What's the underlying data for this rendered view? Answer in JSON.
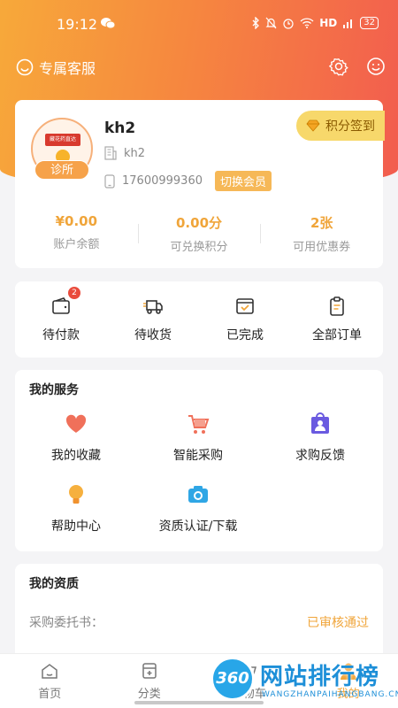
{
  "status_bar": {
    "time": "19:12",
    "network": "HD",
    "battery": "32"
  },
  "topbar": {
    "customer_service": "专属客服"
  },
  "profile": {
    "avatar_sign_text": "藏花药直达",
    "clinic_tag": "诊所",
    "username": "kh2",
    "org_name": "kh2",
    "phone": "17600999360",
    "switch_member": "切换会员",
    "points_signin": "积分签到",
    "stats": [
      {
        "value": "¥0.00",
        "label": "账户余额"
      },
      {
        "value": "0.00分",
        "label": "可兑换积分"
      },
      {
        "value": "2张",
        "label": "可用优惠券"
      }
    ]
  },
  "orders": [
    {
      "label": "待付款",
      "badge": "2",
      "icon": "wallet-icon"
    },
    {
      "label": "待收货",
      "icon": "truck-icon"
    },
    {
      "label": "已完成",
      "icon": "check-box-icon"
    },
    {
      "label": "全部订单",
      "icon": "clipboard-icon"
    }
  ],
  "services": {
    "title": "我的服务",
    "items": [
      {
        "label": "我的收藏",
        "icon": "heart-icon"
      },
      {
        "label": "智能采购",
        "icon": "cart-icon"
      },
      {
        "label": "求购反馈",
        "icon": "feedback-bag-icon"
      },
      {
        "label": "帮助中心",
        "icon": "bulb-icon"
      },
      {
        "label": "资质认证/下载",
        "icon": "camera-icon"
      }
    ]
  },
  "qualification": {
    "title": "我的资质",
    "row_key": "采购委托书：",
    "row_value": "已审核通过"
  },
  "tabbar": [
    {
      "label": "首页",
      "icon": "home-icon"
    },
    {
      "label": "分类",
      "icon": "category-icon"
    },
    {
      "label": "购物车",
      "icon": "cart-tab-icon"
    },
    {
      "label": "我的",
      "icon": "profile-tab-icon"
    }
  ],
  "watermark": {
    "badge": "360",
    "title": "网站排行榜",
    "sub": "WANGZHANPAIHANGBANG.CN"
  },
  "colors": {
    "brand_orange": "#f6873f",
    "accent_gold": "#f0a53a",
    "header_red": "#f25c4f"
  }
}
